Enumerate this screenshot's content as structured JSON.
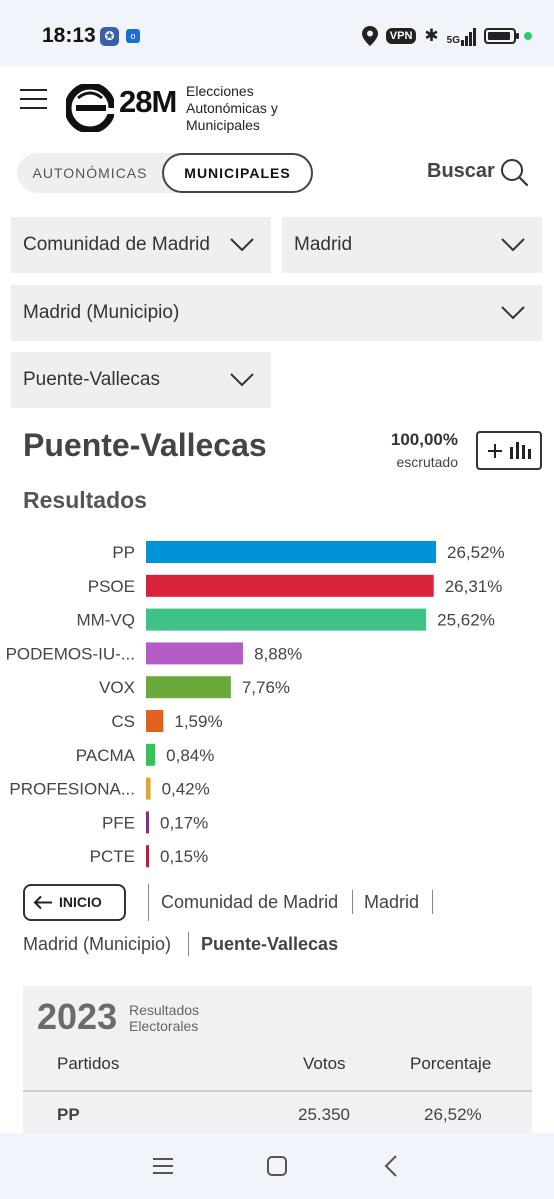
{
  "status_bar": {
    "time": "18:13",
    "vpn": "VPN",
    "network": "5G",
    "icons": [
      "app-badge-icon",
      "outlook-icon",
      "location-icon",
      "bluetooth-icon",
      "signal-icon",
      "battery-icon",
      "status-dot-icon"
    ]
  },
  "header": {
    "brand": "28M",
    "brand_subtitle": "Elecciones Autonómicas y Municipales",
    "icons": [
      "menu-icon",
      "logo-icon"
    ]
  },
  "tabs": {
    "autonomicas": "AUTONÓMICAS",
    "municipales": "MUNICIPALES",
    "active": "municipales"
  },
  "search": {
    "label": "Buscar",
    "icon": "search-icon"
  },
  "filters": {
    "community": "Comunidad de Madrid",
    "province": "Madrid",
    "municipality": "Madrid (Municipio)",
    "district": "Puente-Vallecas"
  },
  "result_header": {
    "place": "Puente-Vallecas",
    "scrutiny_pct": "100,00%",
    "scrutiny_label": "escrutado",
    "section_title": "Resultados"
  },
  "chart_data": {
    "type": "bar",
    "orientation": "horizontal",
    "categories": [
      "PP",
      "PSOE",
      "MM-VQ",
      "PODEMOS-IU-...",
      "VOX",
      "CS",
      "PACMA",
      "PROFESIONA...",
      "PFE",
      "PCTE"
    ],
    "values": [
      26.52,
      26.31,
      25.62,
      8.88,
      7.76,
      1.59,
      0.84,
      0.42,
      0.17,
      0.15
    ],
    "labels": [
      "26,52%",
      "26,31%",
      "25,62%",
      "8,88%",
      "7,76%",
      "1,59%",
      "0,84%",
      "0,42%",
      "0,17%",
      "0,15%"
    ],
    "colors": [
      "#0093d7",
      "#d8213b",
      "#3ec286",
      "#b55cc4",
      "#6aaa3a",
      "#e1621f",
      "#37c15a",
      "#e0a62a",
      "#8a2b86",
      "#c41a3a"
    ],
    "xlim": [
      0,
      26.52
    ]
  },
  "breadcrumb": {
    "back_label": "INICIO",
    "items": [
      "Comunidad de Madrid",
      "Madrid",
      "Madrid (Municipio)",
      "Puente-Vallecas"
    ]
  },
  "results_table": {
    "year": "2023",
    "subtitle": "Resultados Electorales",
    "columns": [
      "Partidos",
      "Votos",
      "Porcentaje"
    ],
    "rows": [
      {
        "party": "PP",
        "votes": "25.350",
        "pct": "26,52%"
      }
    ]
  },
  "nav_bar": {
    "icons": [
      "recent-apps-icon",
      "home-icon",
      "back-icon"
    ]
  }
}
